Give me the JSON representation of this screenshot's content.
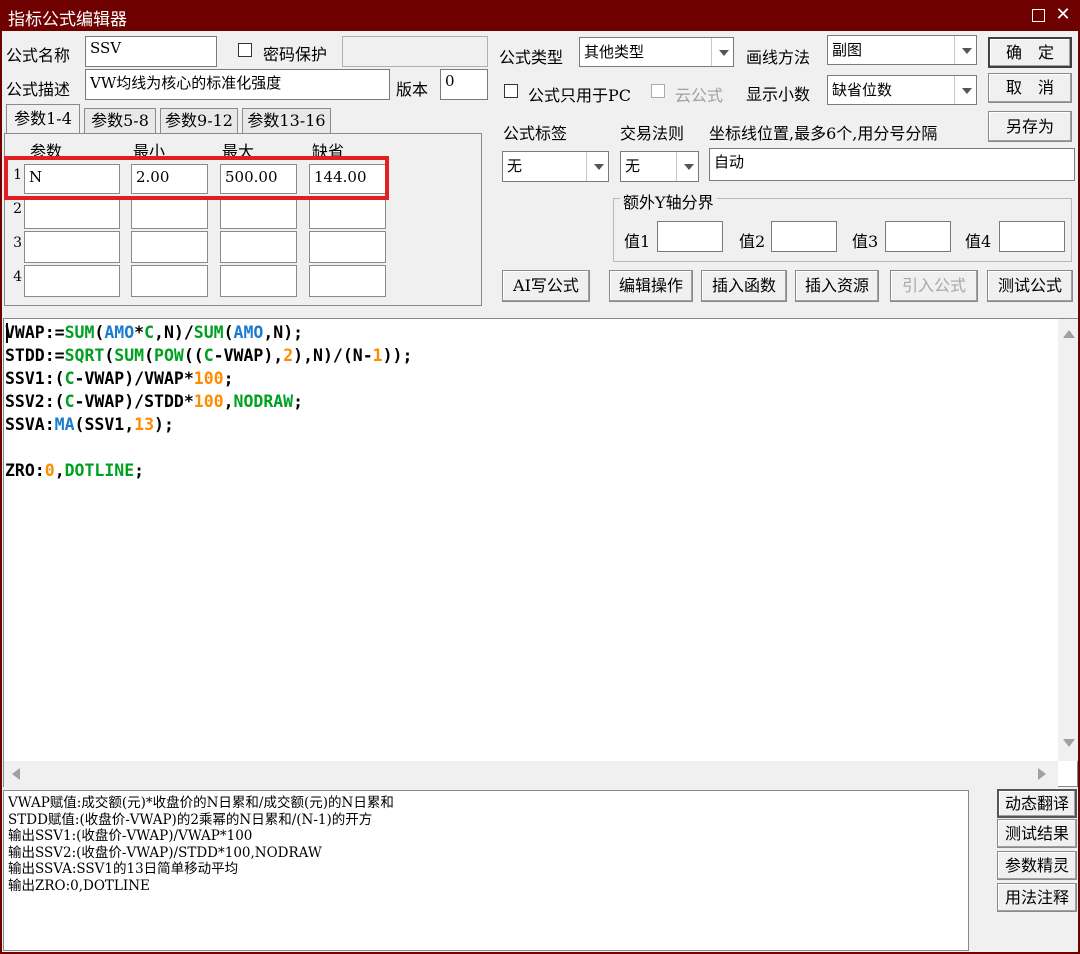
{
  "window": {
    "title": "指标公式编辑器",
    "maximize_icon": "maximize-icon",
    "close_icon": "close-icon"
  },
  "header": {
    "name_label": "公式名称",
    "name_value": "SSV",
    "password_label": "密码保护",
    "password_value": "",
    "desc_label": "公式描述",
    "desc_value": "VW均线为核心的标准化强度",
    "version_label": "版本",
    "version_value": "0",
    "type_label": "公式类型",
    "type_value": "其他类型",
    "draw_label": "画线方法",
    "draw_value": "副图",
    "pc_only_label": "公式只用于PC",
    "cloud_label": "云公式",
    "decimals_label": "显示小数",
    "decimals_value": "缺省位数",
    "ok_button": "确　定",
    "cancel_button": "取　消",
    "saveas_button": "另存为"
  },
  "params": {
    "tabs": [
      "参数1-4",
      "参数5-8",
      "参数9-12",
      "参数13-16"
    ],
    "columns": [
      "参数",
      "最小",
      "最大",
      "缺省"
    ],
    "rows": [
      {
        "num": "1",
        "name": "N",
        "min": "2.00",
        "max": "500.00",
        "default": "144.00"
      },
      {
        "num": "2",
        "name": "",
        "min": "",
        "max": "",
        "default": ""
      },
      {
        "num": "3",
        "name": "",
        "min": "",
        "max": "",
        "default": ""
      },
      {
        "num": "4",
        "name": "",
        "min": "",
        "max": "",
        "default": ""
      }
    ],
    "highlight_color": "#e02020"
  },
  "right_panel": {
    "tag_label": "公式标签",
    "trade_label": "交易法则",
    "coord_label": "坐标线位置,最多6个,用分号分隔",
    "tag_value": "无",
    "trade_value": "无",
    "coord_value": "自动",
    "yaxis_group": "额外Y轴分界",
    "val1": "值1",
    "val2": "值2",
    "val3": "值3",
    "val4": "值4"
  },
  "toolbar": {
    "ai_button": "AI写公式",
    "edit_button": "编辑操作",
    "insert_fn_button": "插入函数",
    "insert_res_button": "插入资源",
    "import_button": "引入公式",
    "test_button": "测试公式"
  },
  "code_lines": [
    [
      [
        "VWAP:=",
        ""
      ],
      [
        "SUM",
        "fn"
      ],
      [
        "(",
        ""
      ],
      [
        "AMO",
        "var"
      ],
      [
        "*",
        ""
      ],
      [
        "C",
        "fn"
      ],
      [
        ",N)/",
        ""
      ],
      [
        "SUM",
        "fn"
      ],
      [
        "(",
        ""
      ],
      [
        "AMO",
        "var"
      ],
      [
        ",N);",
        ""
      ]
    ],
    [
      [
        "STDD:=",
        ""
      ],
      [
        "SQRT",
        "fn"
      ],
      [
        "(",
        ""
      ],
      [
        "SUM",
        "fn"
      ],
      [
        "(",
        ""
      ],
      [
        "POW",
        "fn"
      ],
      [
        "((",
        ""
      ],
      [
        "C",
        "fn"
      ],
      [
        "-VWAP),",
        ""
      ],
      [
        "2",
        "num"
      ],
      [
        "),N)/(N-",
        ""
      ],
      [
        "1",
        "num"
      ],
      [
        "));",
        ""
      ]
    ],
    [
      [
        "SSV1:(",
        ""
      ],
      [
        "C",
        "fn"
      ],
      [
        "-VWAP)/VWAP*",
        ""
      ],
      [
        "100",
        "num"
      ],
      [
        ";",
        ""
      ]
    ],
    [
      [
        "SSV2:(",
        ""
      ],
      [
        "C",
        "fn"
      ],
      [
        "-VWAP)/STDD*",
        ""
      ],
      [
        "100",
        "num"
      ],
      [
        ",",
        ""
      ],
      [
        "NODRAW",
        "fn"
      ],
      [
        ";",
        ""
      ]
    ],
    [
      [
        "SSVA:",
        ""
      ],
      [
        "MA",
        "var"
      ],
      [
        "(SSV1,",
        ""
      ],
      [
        "13",
        "num"
      ],
      [
        ");",
        ""
      ]
    ],
    [],
    [
      [
        "ZRO:",
        ""
      ],
      [
        "0",
        "num"
      ],
      [
        ",",
        ""
      ],
      [
        "DOTLINE",
        "fn"
      ],
      [
        ";",
        ""
      ]
    ]
  ],
  "description": "VWAP赋值:成交额(元)*收盘价的N日累和/成交额(元)的N日累和\nSTDD赋值:(收盘价-VWAP)的2乘幂的N日累和/(N-1)的开方\n输出SSV1:(收盘价-VWAP)/VWAP*100\n输出SSV2:(收盘价-VWAP)/STDD*100,NODRAW\n输出SSVA:SSV1的13日简单移动平均\n输出ZRO:0,DOTLINE",
  "side_buttons": [
    "动态翻译",
    "测试结果",
    "参数精灵",
    "用法注释"
  ],
  "colors": {
    "titlebar": "#6f0000",
    "function": "#00a020",
    "variable": "#1a7ad0",
    "number": "#ff8c00"
  }
}
